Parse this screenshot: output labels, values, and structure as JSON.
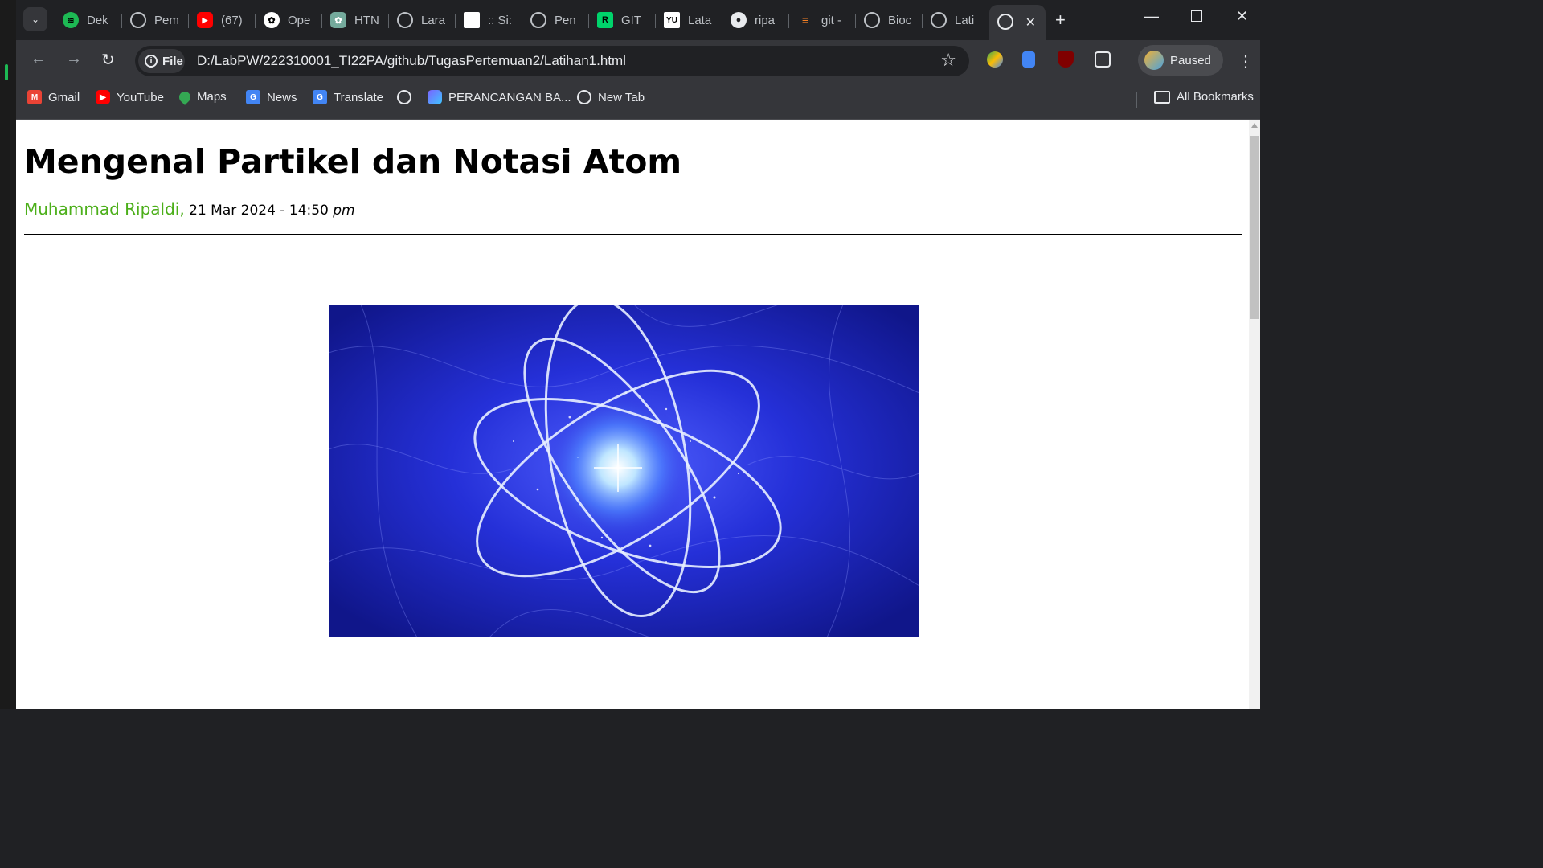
{
  "browser": {
    "tabs": [
      {
        "label": "Dek",
        "icon": "spotify-icon"
      },
      {
        "label": "Pem",
        "icon": "globe-icon"
      },
      {
        "label": "(67)",
        "icon": "youtube-icon"
      },
      {
        "label": "Ope",
        "icon": "openai-icon"
      },
      {
        "label": "HTN",
        "icon": "chatgpt-icon"
      },
      {
        "label": "Lara",
        "icon": "laracasts-icon"
      },
      {
        "label": ":: Si:",
        "icon": "document-icon"
      },
      {
        "label": "Pen",
        "icon": "globe-icon"
      },
      {
        "label": "GIT",
        "icon": "git-icon"
      },
      {
        "label": "Lata",
        "icon": "yu-icon"
      },
      {
        "label": "ripa",
        "icon": "github-icon"
      },
      {
        "label": "git -",
        "icon": "stackoverflow-icon"
      },
      {
        "label": "Bioc",
        "icon": "globe-icon"
      },
      {
        "label": "Lati",
        "icon": "globe-icon"
      }
    ],
    "active_tab": {
      "icon": "globe-icon",
      "close_label": "✕"
    },
    "new_tab_label": "+",
    "address": {
      "chip_label": "File",
      "url": "D:/LabPW/222310001_TI22PA/github/TugasPertemuan2/Latihan1.html"
    },
    "profile_label": "Paused",
    "bookmarks": [
      {
        "label": "Gmail",
        "icon": "gmail-icon"
      },
      {
        "label": "YouTube",
        "icon": "youtube-icon"
      },
      {
        "label": "Maps",
        "icon": "maps-icon"
      },
      {
        "label": "News",
        "icon": "news-icon"
      },
      {
        "label": "Translate",
        "icon": "translate-icon"
      },
      {
        "label": "",
        "icon": "globe-icon"
      },
      {
        "label": "PERANCANGAN BA...",
        "icon": "app-icon"
      },
      {
        "label": "New Tab",
        "icon": "globe-icon"
      }
    ],
    "all_bookmarks_label": "All Bookmarks"
  },
  "page": {
    "title": "Mengenal Partikel dan Notasi Atom",
    "author": "Muhammad Ripaldi,",
    "date": "21 Mar 2024 - 14:50",
    "ampm": "pm"
  },
  "colors": {
    "author": "#4caf1a",
    "tab_bar": "#202124",
    "toolbar": "#35363a"
  }
}
